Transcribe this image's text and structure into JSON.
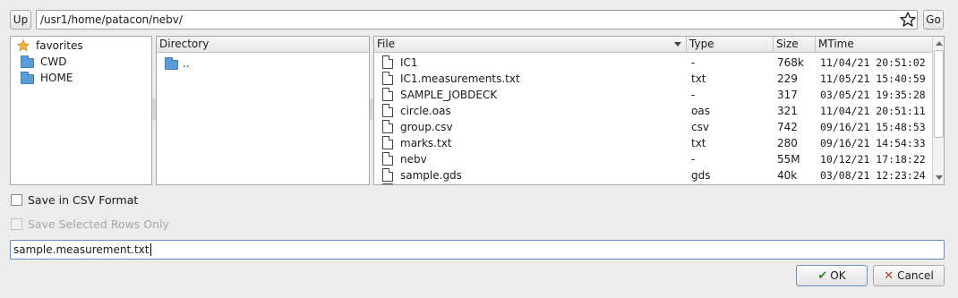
{
  "toolbar": {
    "up_label": "Up",
    "path_value": "/usr1/home/patacon/nebv/",
    "go_label": "Go",
    "bookmark_icon": "star-outline-icon"
  },
  "places": [
    {
      "label": "favorites",
      "icon": "star-icon"
    },
    {
      "label": "CWD",
      "icon": "folder-icon"
    },
    {
      "label": "HOME",
      "icon": "folder-icon"
    }
  ],
  "directory": {
    "header": "Directory",
    "items": [
      {
        "label": ".."
      }
    ]
  },
  "files": {
    "columns": {
      "file": "File",
      "type": "Type",
      "size": "Size",
      "mtime": "MTime"
    },
    "rows": [
      {
        "name": "IC1",
        "type": "-",
        "size": "768k",
        "mtime": "11/04/21 20:51:02"
      },
      {
        "name": "IC1.measurements.txt",
        "type": "txt",
        "size": "229",
        "mtime": "11/05/21 15:40:59"
      },
      {
        "name": "SAMPLE_JOBDECK",
        "type": "-",
        "size": "317",
        "mtime": "03/05/21 19:35:28"
      },
      {
        "name": "circle.oas",
        "type": "oas",
        "size": "321",
        "mtime": "11/04/21 20:51:11"
      },
      {
        "name": "group.csv",
        "type": "csv",
        "size": "742",
        "mtime": "09/16/21 15:48:53"
      },
      {
        "name": "marks.txt",
        "type": "txt",
        "size": "280",
        "mtime": "09/16/21 14:54:33"
      },
      {
        "name": "nebv",
        "type": "-",
        "size": "55M",
        "mtime": "10/12/21 17:18:22"
      },
      {
        "name": "sample.gds",
        "type": "gds",
        "size": "40k",
        "mtime": "03/08/21 12:23:24"
      }
    ]
  },
  "options": {
    "save_csv_label": "Save in CSV Format",
    "save_selected_label": "Save Selected Rows Only"
  },
  "filename_value": "sample.measurement.txt",
  "buttons": {
    "ok_label": "OK",
    "cancel_label": "Cancel"
  },
  "colors": {
    "folder": "#5a9bd8",
    "star": "#f0b43c",
    "cancel_x": "#c0392b",
    "ok_check": "#3a7a2a"
  }
}
